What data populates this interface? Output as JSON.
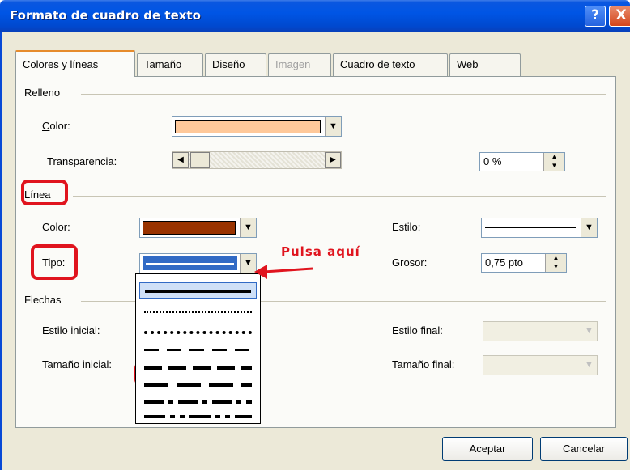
{
  "window": {
    "title": "Formato de cuadro de texto",
    "help_glyph": "?",
    "close_glyph": "X"
  },
  "tabs": [
    {
      "label": "Colores y líneas",
      "active": true
    },
    {
      "label": "Tamaño"
    },
    {
      "label": "Diseño"
    },
    {
      "label": "Imagen",
      "disabled": true
    },
    {
      "label": "Cuadro de texto"
    },
    {
      "label": "Web"
    }
  ],
  "relleno": {
    "section_label": "Relleno",
    "color_label": "Color:",
    "color_value": "#fec89a",
    "transparencia_label": "Transparencia:",
    "transparencia_value": "0 %",
    "transparencia_level": 0
  },
  "linea": {
    "section_label": "Línea",
    "color_label": "Color:",
    "color_value": "#993300",
    "tipo_label": "Tipo:",
    "estilo_label": "Estilo:",
    "grosor_label": "Grosor:",
    "grosor_value": "0,75 pto"
  },
  "flechas": {
    "section_label": "Flechas",
    "estilo_inicial_label": "Estilo inicial:",
    "tamano_inicial_label": "Tamaño inicial:",
    "estilo_final_label": "Estilo final:",
    "tamano_final_label": "Tamaño final:"
  },
  "annotation": {
    "text": "Pulsa aquí",
    "color": "#e0141e"
  },
  "buttons": {
    "ok": "Aceptar",
    "cancel": "Cancelar"
  },
  "icons": {
    "dropdown_arrow": "chevron-down-icon",
    "scroll_left": "arrow-left-icon",
    "scroll_right": "arrow-right-icon"
  }
}
